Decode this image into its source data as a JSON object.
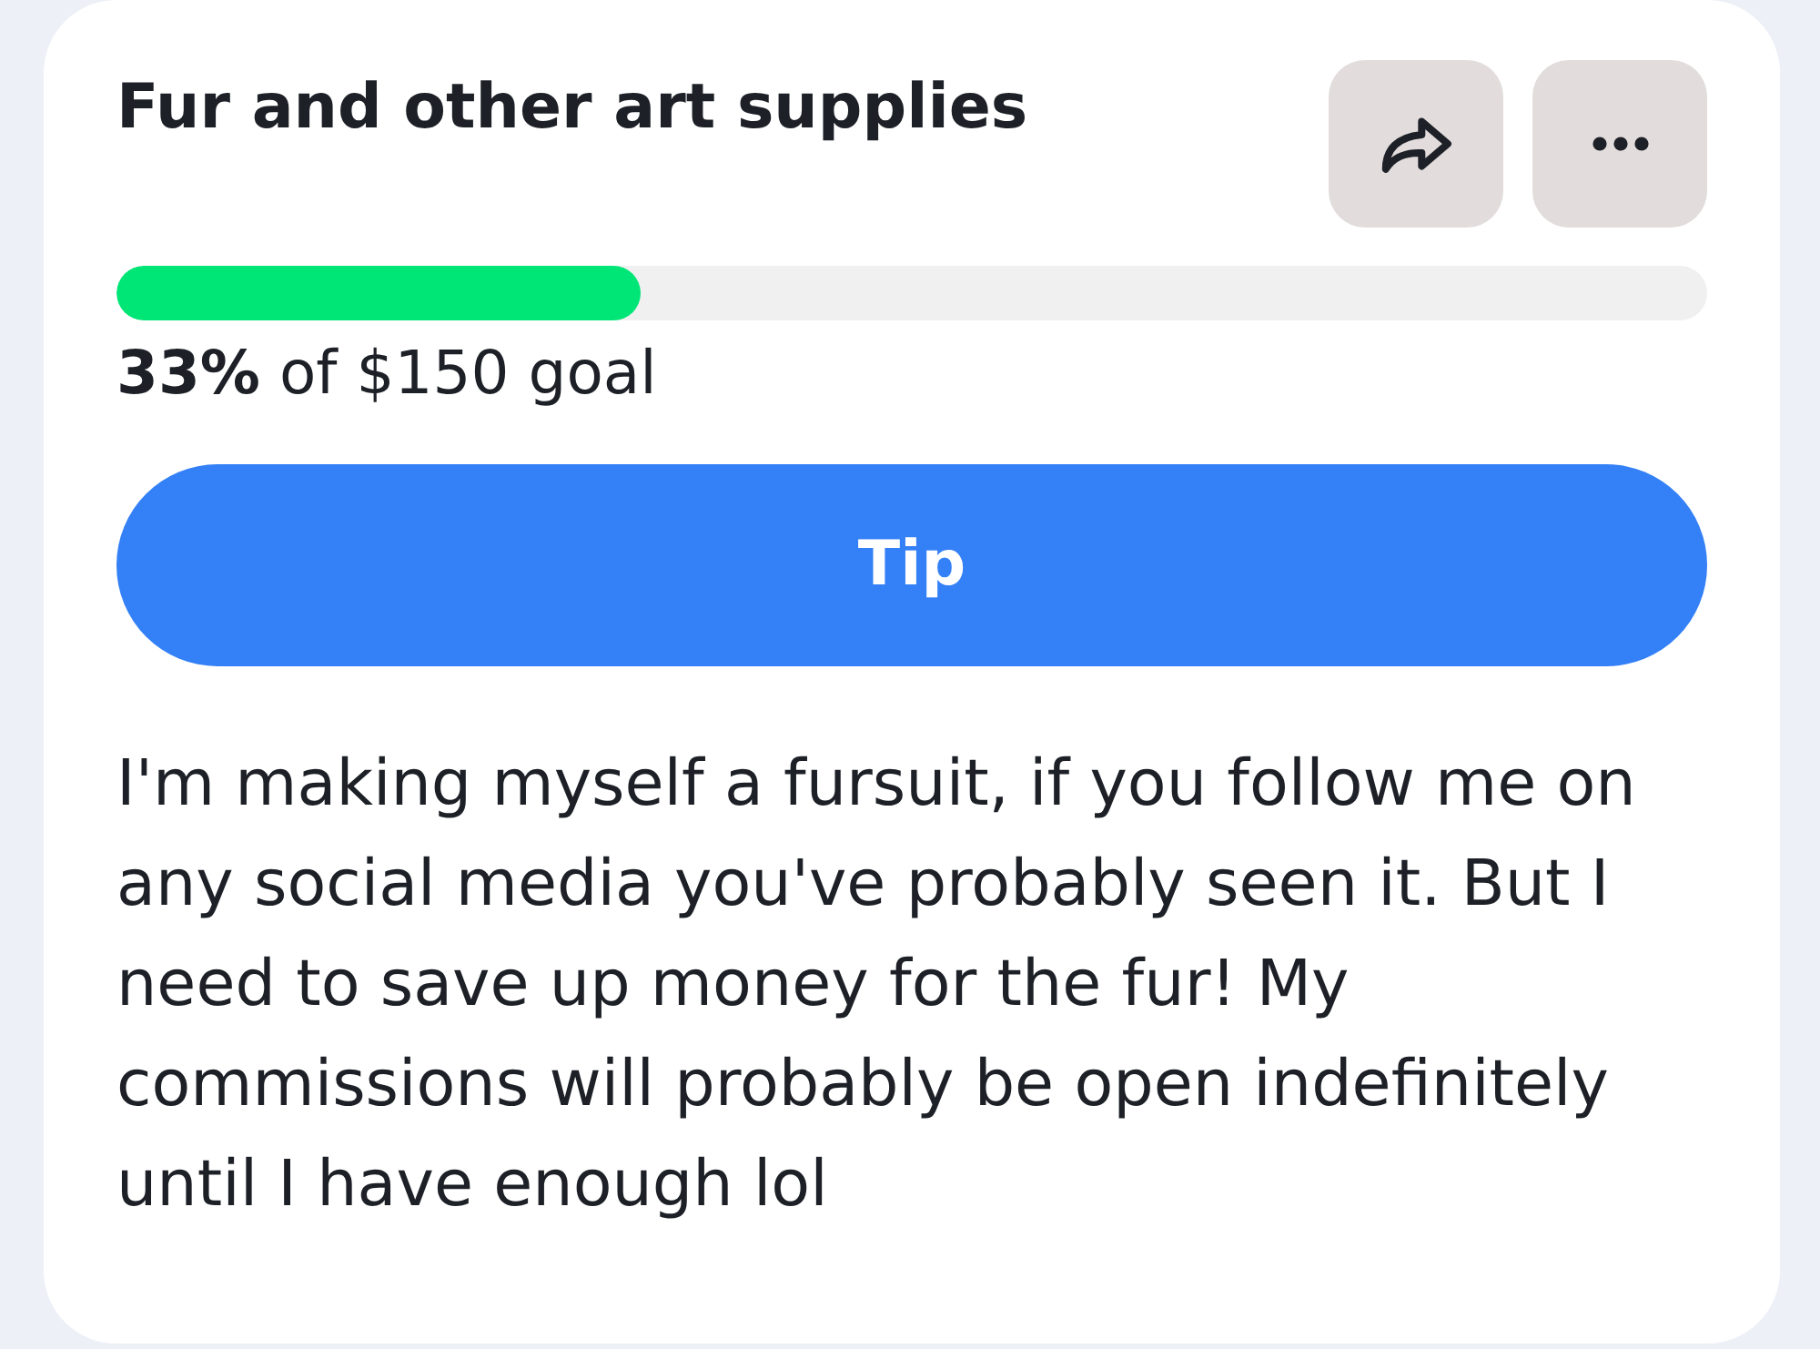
{
  "card": {
    "title": "Fur and other art supplies",
    "progress": {
      "level": 0.33,
      "caption": "**33%** of $150 goal"
    },
    "tip_button": {
      "label": "Tip"
    },
    "description": "I'm making myself a fursuit, if you follow me on any social media you've probably seen it. But I need to save up money for the fur! My commissions will probably be open indefinitely until I have enough lol"
  }
}
